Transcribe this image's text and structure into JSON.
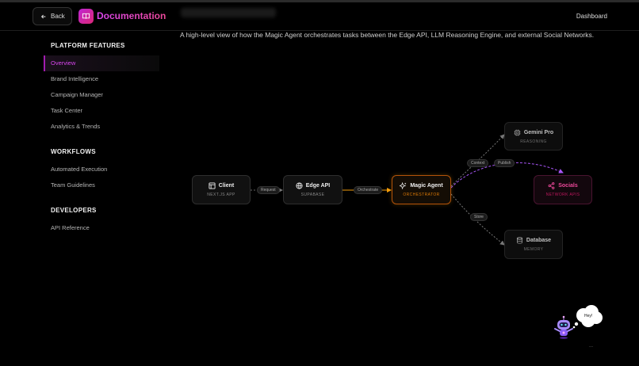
{
  "header": {
    "back_label": "Back",
    "brand_title": "Documentation",
    "dashboard_label": "Dashboard"
  },
  "sidebar": {
    "sections": [
      {
        "title": "PLATFORM FEATURES",
        "items": [
          "Overview",
          "Brand Intelligence",
          "Campaign Manager",
          "Task Center",
          "Analytics & Trends"
        ]
      },
      {
        "title": "WORKFLOWS",
        "items": [
          "Automated Execution",
          "Team Guidelines"
        ]
      },
      {
        "title": "DEVELOPERS",
        "items": [
          "API Reference"
        ]
      }
    ],
    "active_item": "Overview"
  },
  "main": {
    "intro": "A high-level view of how the Magic Agent orchestrates tasks between the Edge API, LLM Reasoning Engine, and external Social Networks."
  },
  "diagram": {
    "nodes": {
      "client": {
        "title": "Client",
        "subtitle": "NEXT.JS APP",
        "icon": "layout-icon"
      },
      "edge_api": {
        "title": "Edge API",
        "subtitle": "SUPABASE",
        "icon": "globe-icon"
      },
      "magic_agent": {
        "title": "Magic Agent",
        "subtitle": "ORCHESTRATOR",
        "icon": "sparkles-icon"
      },
      "gemini": {
        "title": "Gemini Pro",
        "subtitle": "REASONING",
        "icon": "cpu-icon"
      },
      "socials": {
        "title": "Socials",
        "subtitle": "NETWORK APIS",
        "icon": "share-icon"
      },
      "database": {
        "title": "Database",
        "subtitle": "MEMORY",
        "icon": "database-icon"
      }
    },
    "edges": {
      "request": "Request",
      "orchestrate": "Orchestrate",
      "context": "Context",
      "publish": "Publish",
      "store": "Store"
    }
  },
  "assistant": {
    "bubble_text": "Hey!",
    "dots": "..."
  },
  "colors": {
    "accent": "#d946ef",
    "agent": "#f59e0b",
    "socials": "#ec4899",
    "background": "#000000"
  }
}
